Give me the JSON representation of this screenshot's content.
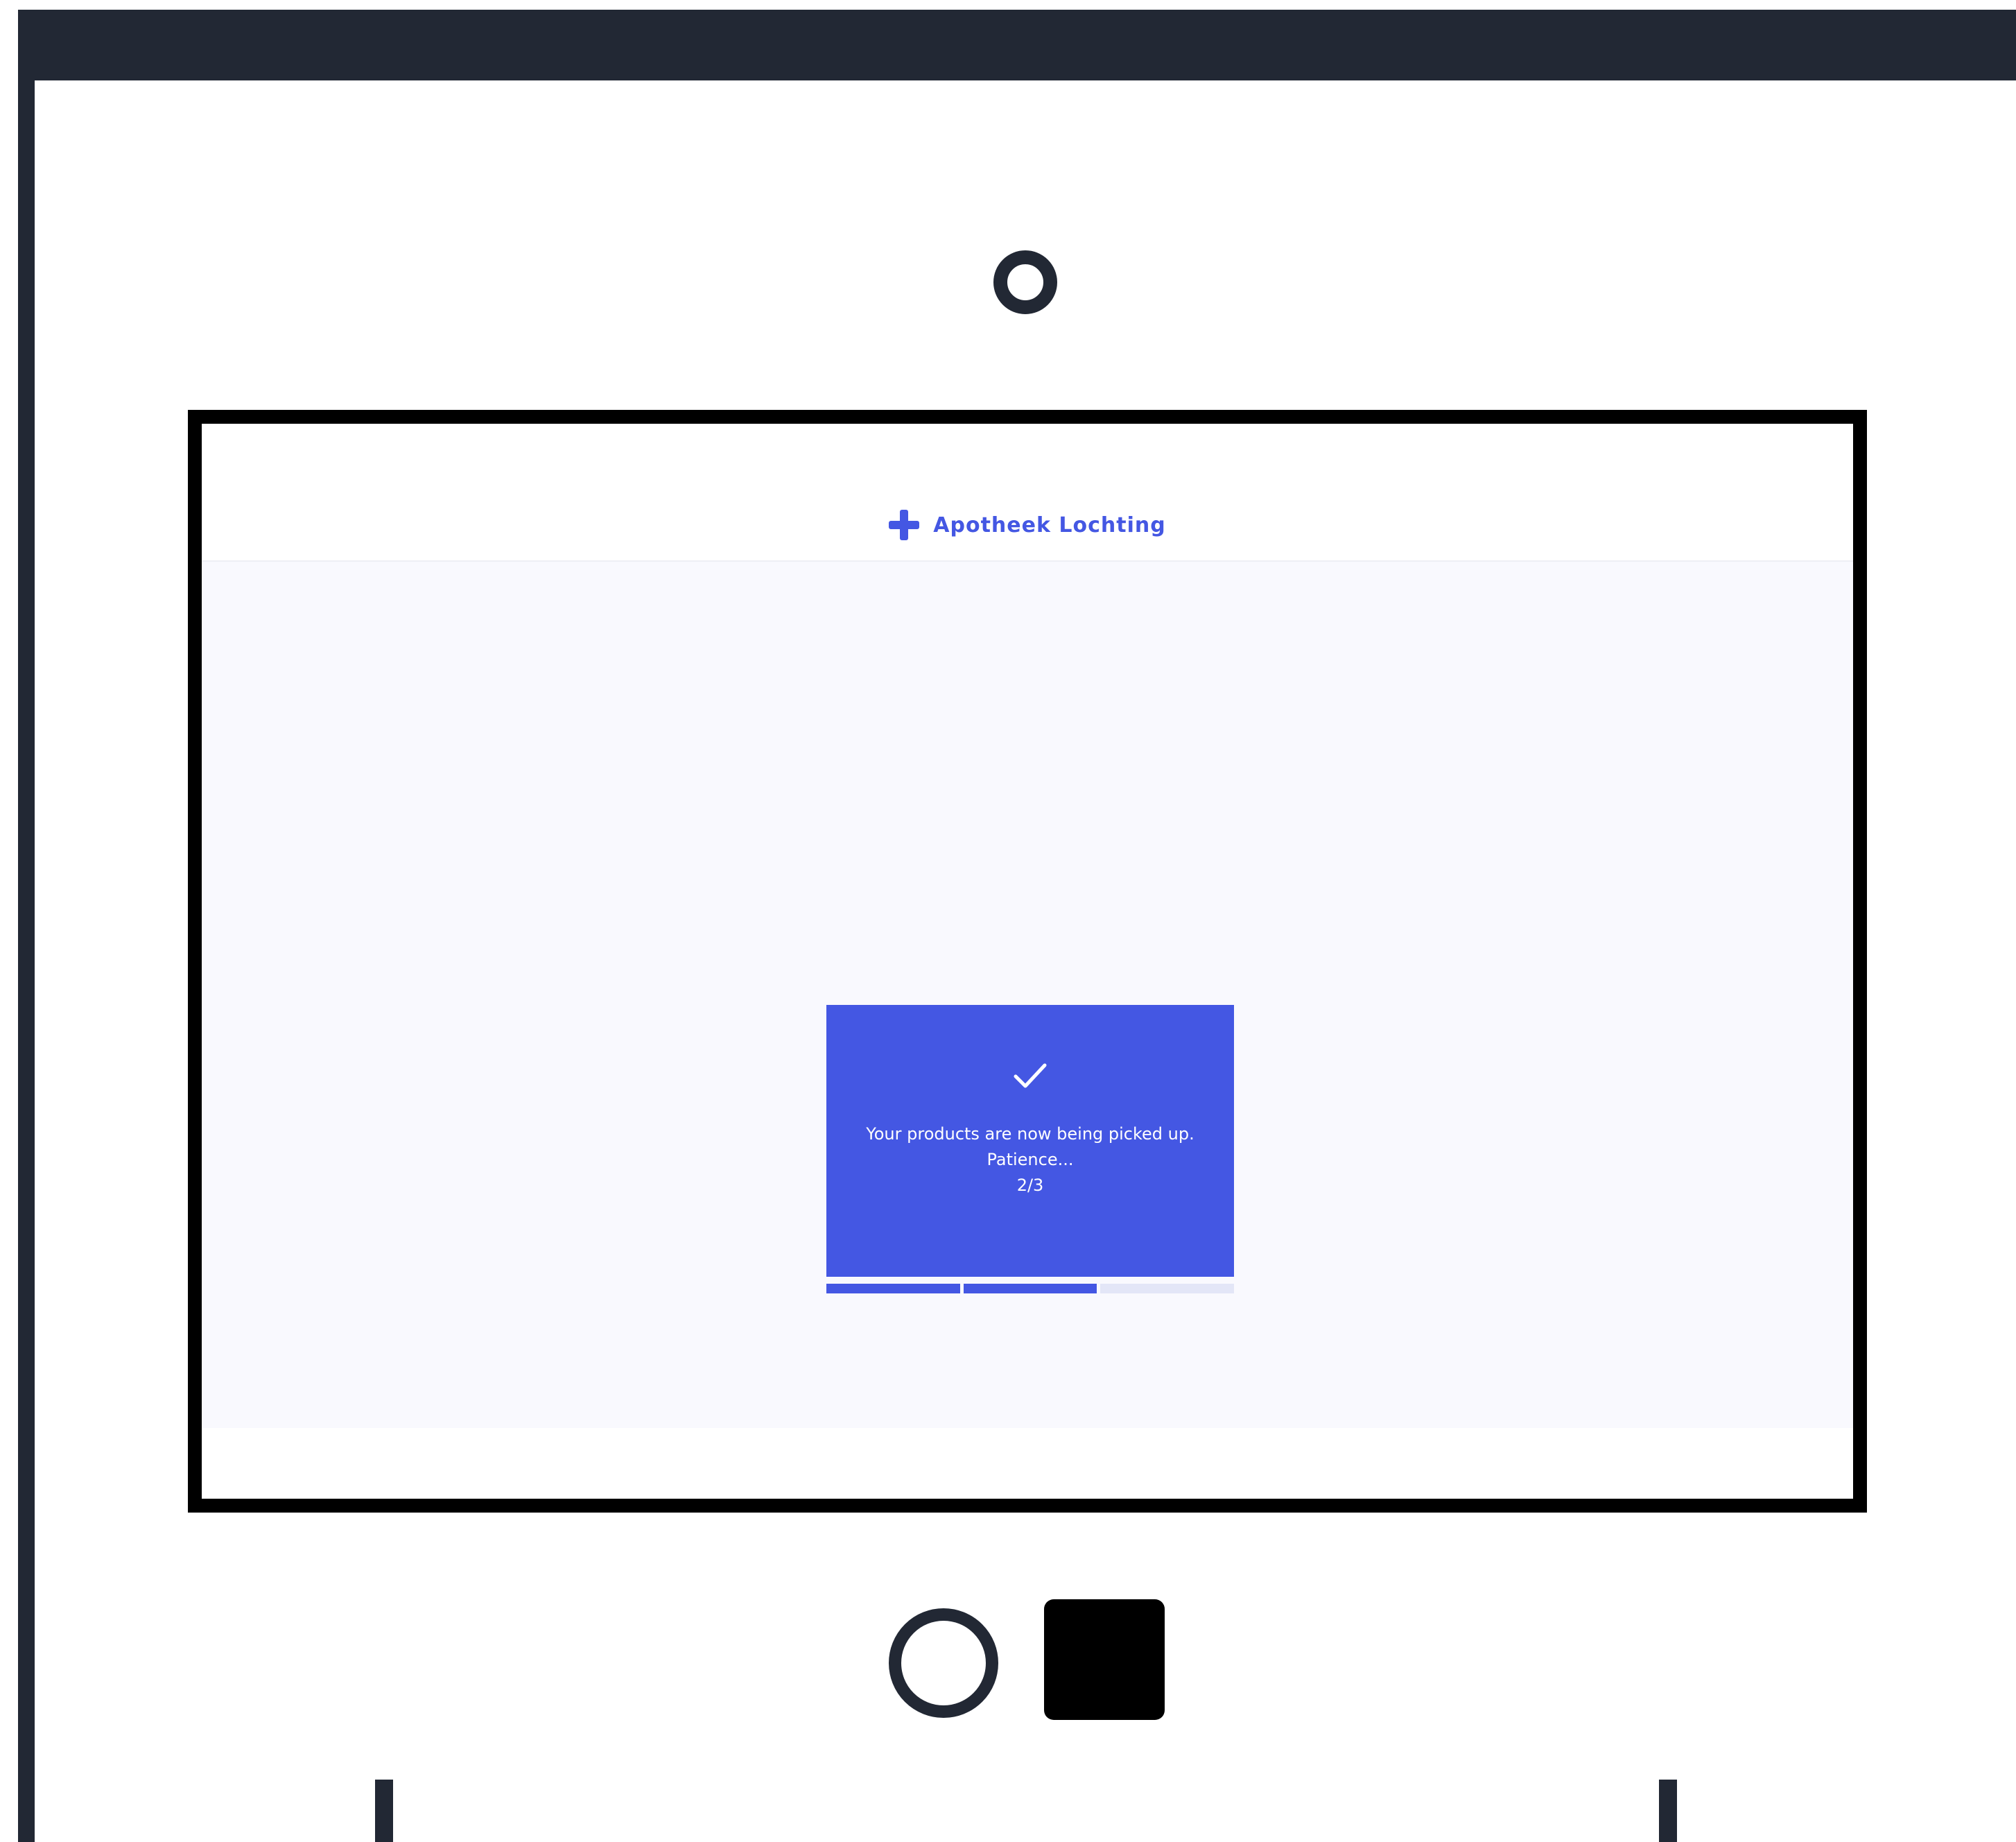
{
  "header": {
    "brand_name": "Apotheek Lochting",
    "brand_icon": "plus-cross-icon"
  },
  "notice": {
    "icon": "checkmark-icon",
    "message": "Your products are now being picked up.",
    "status": "Patience...",
    "step_text": "2/3"
  },
  "progress": {
    "total_steps": 3,
    "segments": [
      1,
      1,
      0
    ]
  },
  "colors": {
    "accent": "#4457e3",
    "device": "#222834",
    "body_bg": "#f9f9fe",
    "track": "#e3e6f7"
  }
}
